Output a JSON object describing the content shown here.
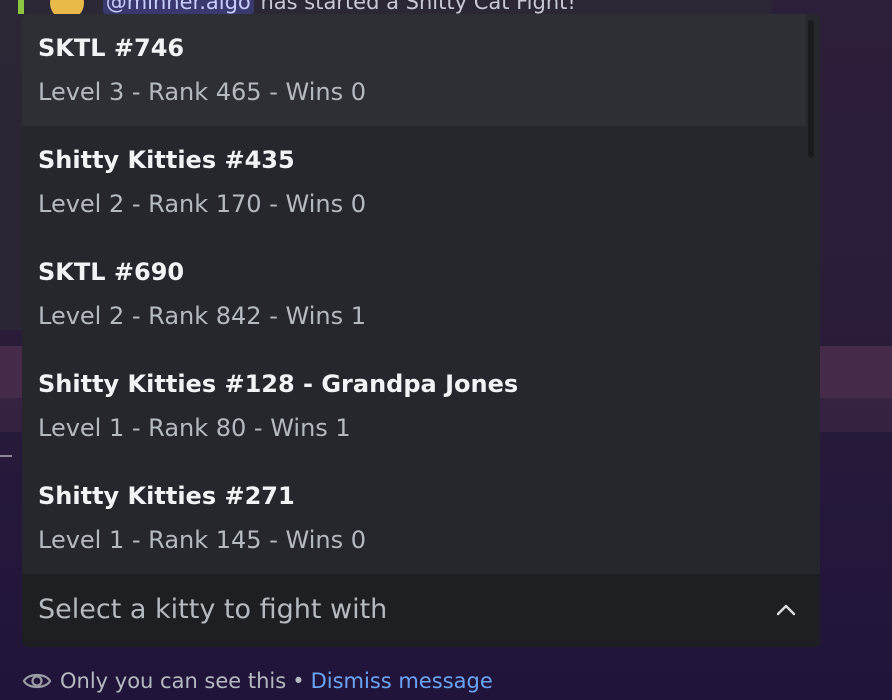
{
  "background": {
    "mention": "@minner.algo",
    "header_text": "has started a Shitty Cat Fight!"
  },
  "dropdown": {
    "options": [
      {
        "title": "SKTL #746",
        "subtitle": "Level 3 - Rank 465 - Wins 0"
      },
      {
        "title": "Shitty Kitties #435",
        "subtitle": "Level 2 - Rank 170 - Wins 0"
      },
      {
        "title": "SKTL #690",
        "subtitle": "Level 2 - Rank 842 - Wins 1"
      },
      {
        "title": "Shitty Kitties #128 - Grandpa Jones",
        "subtitle": "Level 1 - Rank 80 - Wins 1"
      },
      {
        "title": "Shitty Kitties #271",
        "subtitle": "Level 1 - Rank 145 - Wins 0"
      }
    ]
  },
  "select": {
    "placeholder": "Select a kitty to fight with",
    "icon": "chevron-up-icon"
  },
  "footer": {
    "icon": "eye-icon",
    "text": "Only you can see this",
    "separator": "•",
    "link": "Dismiss message"
  },
  "colors": {
    "link": "#6ba4f5",
    "dropdown_bg": "#26272d",
    "select_bg": "#1e1f22",
    "accent_bar": "#8cc63f"
  }
}
